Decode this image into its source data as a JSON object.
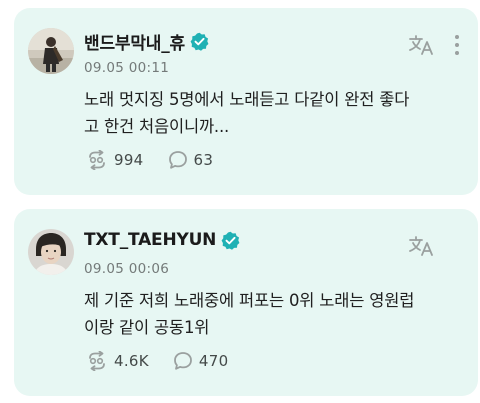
{
  "posts": [
    {
      "author": "밴드부막내_휴",
      "verified": true,
      "timestamp": "09.05 00:11",
      "body_lines": [
        "노래 멋지징 5명에서 노래듣고 다같이 완전 좋다",
        "고 한건 처음이니까..."
      ],
      "reposts": "994",
      "replies": "63",
      "avatar_icon": "user-avatar-guitar"
    },
    {
      "author": "TXT_TAEHYUN",
      "verified": true,
      "timestamp": "09.05 00:06",
      "body_lines": [
        "제 기준 저희 노래중에 퍼포는 0위 노래는 영원럽",
        "이랑 같이 공동1위"
      ],
      "reposts": "4.6K",
      "replies": "470",
      "avatar_icon": "user-avatar-portrait"
    }
  ],
  "colors": {
    "card_bg": "#e7f7f3",
    "verified_badge": "#1fb1b4",
    "icon_gray": "#9aa09f"
  }
}
